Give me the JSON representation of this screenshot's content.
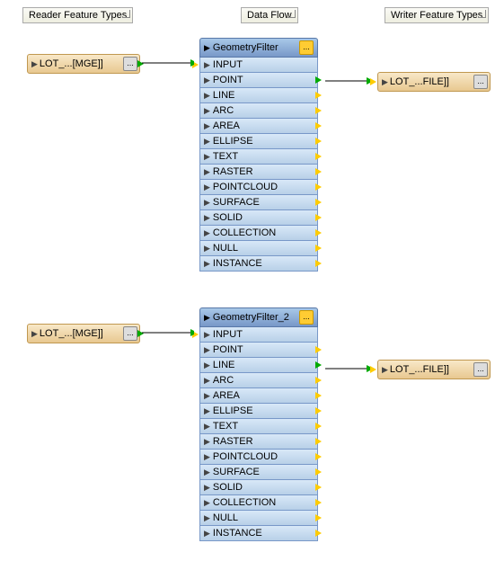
{
  "headers": {
    "reader": "Reader Feature Types",
    "dataflow": "Data Flow",
    "writer": "Writer Feature Types"
  },
  "readers": [
    {
      "label": "LOT_...[MGE]]",
      "btn": "..."
    },
    {
      "label": "LOT_...[MGE]]",
      "btn": "..."
    }
  ],
  "writers": [
    {
      "label": "LOT_...FILE]]",
      "btn": "..."
    },
    {
      "label": "LOT_...FILE]]",
      "btn": "..."
    }
  ],
  "transformers": [
    {
      "name": "GeometryFilter",
      "gear": "...",
      "ports": [
        "INPUT",
        "POINT",
        "LINE",
        "ARC",
        "AREA",
        "ELLIPSE",
        "TEXT",
        "RASTER",
        "POINTCLOUD",
        "SURFACE",
        "SOLID",
        "COLLECTION",
        "NULL",
        "INSTANCE"
      ]
    },
    {
      "name": "GeometryFilter_2",
      "gear": "...",
      "ports": [
        "INPUT",
        "POINT",
        "LINE",
        "ARC",
        "AREA",
        "ELLIPSE",
        "TEXT",
        "RASTER",
        "POINTCLOUD",
        "SURFACE",
        "SOLID",
        "COLLECTION",
        "NULL",
        "INSTANCE"
      ]
    }
  ],
  "chart_data": {
    "type": "diagram",
    "title": "FME Workbench Data Flow",
    "nodes": [
      {
        "id": "r1",
        "type": "reader",
        "label": "LOT_...[MGE]]"
      },
      {
        "id": "r2",
        "type": "reader",
        "label": "LOT_...[MGE]]"
      },
      {
        "id": "t1",
        "type": "transformer",
        "label": "GeometryFilter",
        "ports": [
          "INPUT",
          "POINT",
          "LINE",
          "ARC",
          "AREA",
          "ELLIPSE",
          "TEXT",
          "RASTER",
          "POINTCLOUD",
          "SURFACE",
          "SOLID",
          "COLLECTION",
          "NULL",
          "INSTANCE"
        ]
      },
      {
        "id": "t2",
        "type": "transformer",
        "label": "GeometryFilter_2",
        "ports": [
          "INPUT",
          "POINT",
          "LINE",
          "ARC",
          "AREA",
          "ELLIPSE",
          "TEXT",
          "RASTER",
          "POINTCLOUD",
          "SURFACE",
          "SOLID",
          "COLLECTION",
          "NULL",
          "INSTANCE"
        ]
      },
      {
        "id": "w1",
        "type": "writer",
        "label": "LOT_...FILE]]"
      },
      {
        "id": "w2",
        "type": "writer",
        "label": "LOT_...FILE]]"
      }
    ],
    "edges": [
      {
        "from": "r1",
        "to": "t1",
        "to_port": "INPUT"
      },
      {
        "from": "t1",
        "from_port": "POINT",
        "to": "w1"
      },
      {
        "from": "r2",
        "to": "t2",
        "to_port": "INPUT"
      },
      {
        "from": "t2",
        "from_port": "LINE",
        "to": "w2"
      }
    ]
  }
}
